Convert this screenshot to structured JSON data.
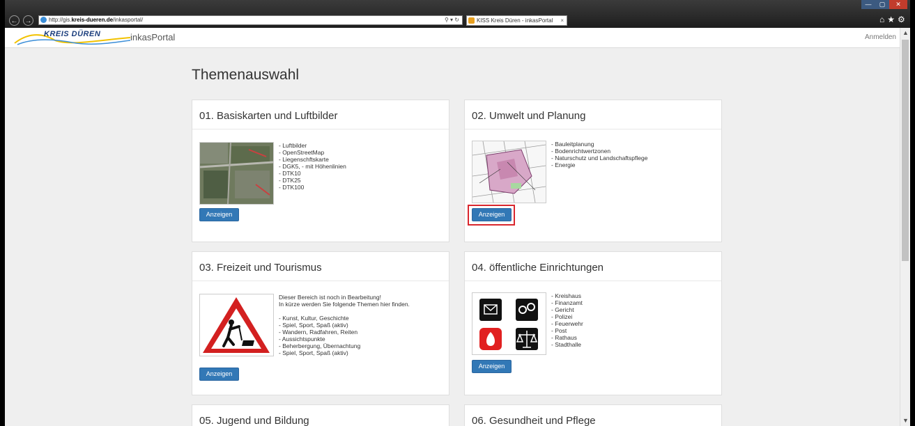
{
  "browser": {
    "url_prefix": "http://gis.",
    "url_domain": "kreis-dueren.de",
    "url_path": "/inkasportal/",
    "search_icons": "⚲ ▾ ↻",
    "tab_title": "KISS Kreis Düren - inkasPortal",
    "tab_close": "×",
    "back": "←",
    "forward": "→",
    "toolbar_icons": "⌂★⚙",
    "win_min": "—",
    "win_max": "▢",
    "win_close": "✕"
  },
  "header": {
    "logo_text": "KREIS DÜREN",
    "brand": "inkasPortal",
    "login": "Anmelden"
  },
  "page": {
    "title": "Themenauswahl"
  },
  "panels": [
    {
      "title": "01. Basiskarten und Luftbilder",
      "items": [
        "- Luftbilder",
        "- OpenStreetMap",
        "- Liegenschftskarte",
        "- DGK5, - mit Höhenlinien",
        "- DTK10",
        "- DTK25",
        "- DTK100"
      ],
      "button": "Anzeigen"
    },
    {
      "title": "02. Umwelt und Planung",
      "items": [
        "- Bauleitplanung",
        "- Bodenrichtwertzonen",
        "- Naturschutz und Landschaftspflege",
        "- Energie"
      ],
      "button": "Anzeigen"
    },
    {
      "title": "03. Freizeit und Tourismus",
      "intro_1": "Dieser Bereich ist noch in Bearbeitung!",
      "intro_2": "In kürze werden Sie folgende Themen hier finden.",
      "items": [
        "- Kunst, Kultur, Geschichte",
        "- Spiel, Sport, Spaß (aktiv)",
        "- Wandern, Radfahren, Reiten",
        "- Aussichtspunkte",
        "- Beherbergung, Übernachtung",
        "- Spiel, Sport, Spaß (aktiv)"
      ],
      "button": "Anzeigen"
    },
    {
      "title": "04. öffentliche Einrichtungen",
      "items": [
        "- Kreishaus",
        "- Finanzamt",
        "- Gericht",
        "- Polizei",
        "- Feuerwehr",
        "- Post",
        "- Rathaus",
        "- Stadthalle"
      ],
      "button": "Anzeigen"
    },
    {
      "title": "05. Jugend und Bildung"
    },
    {
      "title": "06. Gesundheit und Pflege"
    }
  ],
  "colors": {
    "button": "#3278b6",
    "highlight": "#d9262d",
    "logo": "#1a3d7c"
  }
}
